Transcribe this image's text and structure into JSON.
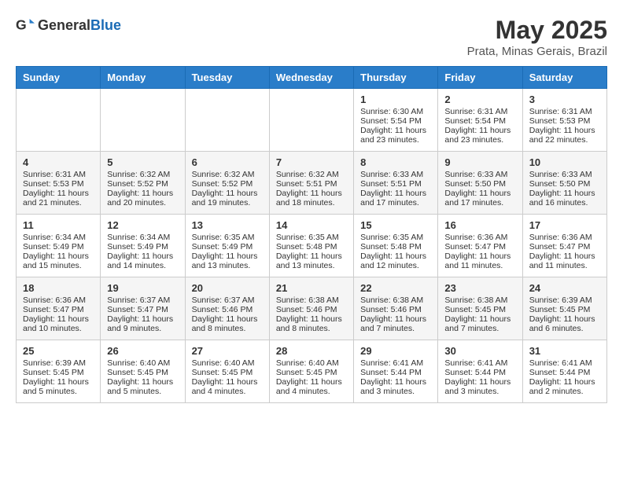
{
  "logo": {
    "general": "General",
    "blue": "Blue"
  },
  "title": {
    "month_year": "May 2025",
    "location": "Prata, Minas Gerais, Brazil"
  },
  "days_of_week": [
    "Sunday",
    "Monday",
    "Tuesday",
    "Wednesday",
    "Thursday",
    "Friday",
    "Saturday"
  ],
  "weeks": [
    [
      {
        "day": "",
        "content": ""
      },
      {
        "day": "",
        "content": ""
      },
      {
        "day": "",
        "content": ""
      },
      {
        "day": "",
        "content": ""
      },
      {
        "day": "1",
        "content": "Sunrise: 6:30 AM\nSunset: 5:54 PM\nDaylight: 11 hours and 23 minutes."
      },
      {
        "day": "2",
        "content": "Sunrise: 6:31 AM\nSunset: 5:54 PM\nDaylight: 11 hours and 23 minutes."
      },
      {
        "day": "3",
        "content": "Sunrise: 6:31 AM\nSunset: 5:53 PM\nDaylight: 11 hours and 22 minutes."
      }
    ],
    [
      {
        "day": "4",
        "content": "Sunrise: 6:31 AM\nSunset: 5:53 PM\nDaylight: 11 hours and 21 minutes."
      },
      {
        "day": "5",
        "content": "Sunrise: 6:32 AM\nSunset: 5:52 PM\nDaylight: 11 hours and 20 minutes."
      },
      {
        "day": "6",
        "content": "Sunrise: 6:32 AM\nSunset: 5:52 PM\nDaylight: 11 hours and 19 minutes."
      },
      {
        "day": "7",
        "content": "Sunrise: 6:32 AM\nSunset: 5:51 PM\nDaylight: 11 hours and 18 minutes."
      },
      {
        "day": "8",
        "content": "Sunrise: 6:33 AM\nSunset: 5:51 PM\nDaylight: 11 hours and 17 minutes."
      },
      {
        "day": "9",
        "content": "Sunrise: 6:33 AM\nSunset: 5:50 PM\nDaylight: 11 hours and 17 minutes."
      },
      {
        "day": "10",
        "content": "Sunrise: 6:33 AM\nSunset: 5:50 PM\nDaylight: 11 hours and 16 minutes."
      }
    ],
    [
      {
        "day": "11",
        "content": "Sunrise: 6:34 AM\nSunset: 5:49 PM\nDaylight: 11 hours and 15 minutes."
      },
      {
        "day": "12",
        "content": "Sunrise: 6:34 AM\nSunset: 5:49 PM\nDaylight: 11 hours and 14 minutes."
      },
      {
        "day": "13",
        "content": "Sunrise: 6:35 AM\nSunset: 5:49 PM\nDaylight: 11 hours and 13 minutes."
      },
      {
        "day": "14",
        "content": "Sunrise: 6:35 AM\nSunset: 5:48 PM\nDaylight: 11 hours and 13 minutes."
      },
      {
        "day": "15",
        "content": "Sunrise: 6:35 AM\nSunset: 5:48 PM\nDaylight: 11 hours and 12 minutes."
      },
      {
        "day": "16",
        "content": "Sunrise: 6:36 AM\nSunset: 5:47 PM\nDaylight: 11 hours and 11 minutes."
      },
      {
        "day": "17",
        "content": "Sunrise: 6:36 AM\nSunset: 5:47 PM\nDaylight: 11 hours and 11 minutes."
      }
    ],
    [
      {
        "day": "18",
        "content": "Sunrise: 6:36 AM\nSunset: 5:47 PM\nDaylight: 11 hours and 10 minutes."
      },
      {
        "day": "19",
        "content": "Sunrise: 6:37 AM\nSunset: 5:47 PM\nDaylight: 11 hours and 9 minutes."
      },
      {
        "day": "20",
        "content": "Sunrise: 6:37 AM\nSunset: 5:46 PM\nDaylight: 11 hours and 8 minutes."
      },
      {
        "day": "21",
        "content": "Sunrise: 6:38 AM\nSunset: 5:46 PM\nDaylight: 11 hours and 8 minutes."
      },
      {
        "day": "22",
        "content": "Sunrise: 6:38 AM\nSunset: 5:46 PM\nDaylight: 11 hours and 7 minutes."
      },
      {
        "day": "23",
        "content": "Sunrise: 6:38 AM\nSunset: 5:45 PM\nDaylight: 11 hours and 7 minutes."
      },
      {
        "day": "24",
        "content": "Sunrise: 6:39 AM\nSunset: 5:45 PM\nDaylight: 11 hours and 6 minutes."
      }
    ],
    [
      {
        "day": "25",
        "content": "Sunrise: 6:39 AM\nSunset: 5:45 PM\nDaylight: 11 hours and 5 minutes."
      },
      {
        "day": "26",
        "content": "Sunrise: 6:40 AM\nSunset: 5:45 PM\nDaylight: 11 hours and 5 minutes."
      },
      {
        "day": "27",
        "content": "Sunrise: 6:40 AM\nSunset: 5:45 PM\nDaylight: 11 hours and 4 minutes."
      },
      {
        "day": "28",
        "content": "Sunrise: 6:40 AM\nSunset: 5:45 PM\nDaylight: 11 hours and 4 minutes."
      },
      {
        "day": "29",
        "content": "Sunrise: 6:41 AM\nSunset: 5:44 PM\nDaylight: 11 hours and 3 minutes."
      },
      {
        "day": "30",
        "content": "Sunrise: 6:41 AM\nSunset: 5:44 PM\nDaylight: 11 hours and 3 minutes."
      },
      {
        "day": "31",
        "content": "Sunrise: 6:41 AM\nSunset: 5:44 PM\nDaylight: 11 hours and 2 minutes."
      }
    ]
  ]
}
